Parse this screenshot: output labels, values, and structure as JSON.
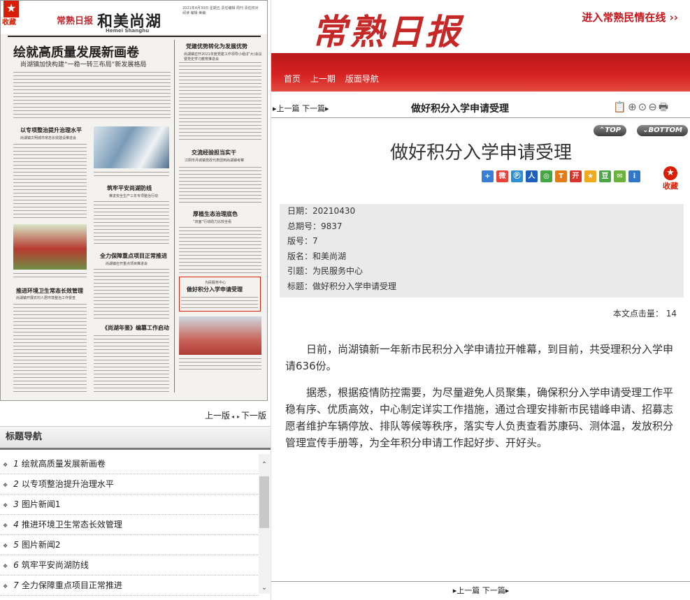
{
  "newspaper_page": {
    "fav_label": "收藏",
    "logo_small": "常熟日报",
    "edition_name": "和美尚湖",
    "edition_en": "Hemei Shanghu",
    "page_info": "2021年4月30日 星期五 责任编辑 周刊 责任校对 阅读 编辑 美编",
    "headline": "绘就高质量发展新画卷",
    "subhead": "尚湖镇加快构建“一稳一转三布局”新发展格局",
    "stories": [
      {
        "title": "党建优势转化为发展优势",
        "sub": "尚湖镇召开2021年度党建工作领导小组(扩大)会议暨党史学习教育推进会"
      },
      {
        "title": "以专项整治提升治理水平",
        "sub": "尚湖镇文明城市常态长效建设推进会"
      },
      {
        "title": "交流经验担当实干",
        "sub": "江阴市月城镇党政代表团到尚湖镇考察"
      },
      {
        "title": "筑牢平安尚湖防线",
        "sub": "推进安全生产三年专项整治行动"
      },
      {
        "title": "厚植生态治理底色",
        "sub": "“双面”行动助力比较全看"
      },
      {
        "title": "全力保障重点项目正常推进",
        "sub": "尚湖镇召开重点项目推进会"
      },
      {
        "title": "推进环境卫生常态长效管理",
        "sub": "尚湖镇开展农村人居环境整治工作督查"
      },
      {
        "title": "为民服务中心",
        "sub": ""
      },
      {
        "title": "做好积分入学申请受理",
        "sub": ""
      },
      {
        "title": "《尚湖年鉴》编篡工作启动",
        "sub": ""
      }
    ]
  },
  "page_nav": {
    "prev": "上一版",
    "next": "下一版"
  },
  "title_nav": {
    "header": "标题导航",
    "items": [
      {
        "num": "1",
        "text": "绘就高质量发展新画卷"
      },
      {
        "num": "2",
        "text": "以专项整治提升治理水平"
      },
      {
        "num": "3",
        "text": "图片新闻1"
      },
      {
        "num": "4",
        "text": "推进环境卫生常态长效管理"
      },
      {
        "num": "5",
        "text": "图片新闻2"
      },
      {
        "num": "6",
        "text": "筑牢平安尚湖防线"
      },
      {
        "num": "7",
        "text": "全力保障重点项目正常推进"
      }
    ]
  },
  "banner": {
    "logo": "常熟日报",
    "minqing_link": "进入常熟民情在线 ››"
  },
  "menu": {
    "home": "首页",
    "prev_issue": "上一期",
    "layout_nav": "版面导航"
  },
  "toolbar": {
    "prev_article": "▸上一篇",
    "next_article": "下一篇▸",
    "title": "做好积分入学申请受理",
    "tools": "📋🔍🔍🔍🖶"
  },
  "topbottom": {
    "top": "⌃TOP",
    "bottom": "⌄BOTTOM"
  },
  "article": {
    "title": "做好积分入学申请受理",
    "fav_label": "收藏",
    "meta": {
      "date_label": "日期：",
      "date": "20210430",
      "issue_label": "总期号：",
      "issue": "9837",
      "page_label": "版号：",
      "page": "7",
      "section_label": "版名：",
      "section": "和美尚湖",
      "intro_label": "引题：",
      "intro": "为民服务中心",
      "title_label": "标题：",
      "title": "做好积分入学申请受理"
    },
    "hits_label": "本文点击量：",
    "hits": "14",
    "paragraphs": [
      "日前，尚湖镇新一年新市民积分入学申请拉开帷幕，到目前，共受理积分入学申请636份。",
      "据悉，根据疫情防控需要，为尽量避免人员聚集，确保积分入学申请受理工作平稳有序、优质高效，中心制定详实工作措施，通过合理安排新市民错峰申请、招募志愿者维护车辆停放、排队等候等秩序，落实专人负责查看苏康码、测体温，发放积分管理宣传手册等，为全年积分申请工作起好步、开好头。"
    ]
  },
  "bottom_nav": {
    "prev": "▸上一篇",
    "next": "下一篇▸"
  },
  "colors": {
    "brand_red": "#c62828",
    "bar_red": "#d62121"
  }
}
